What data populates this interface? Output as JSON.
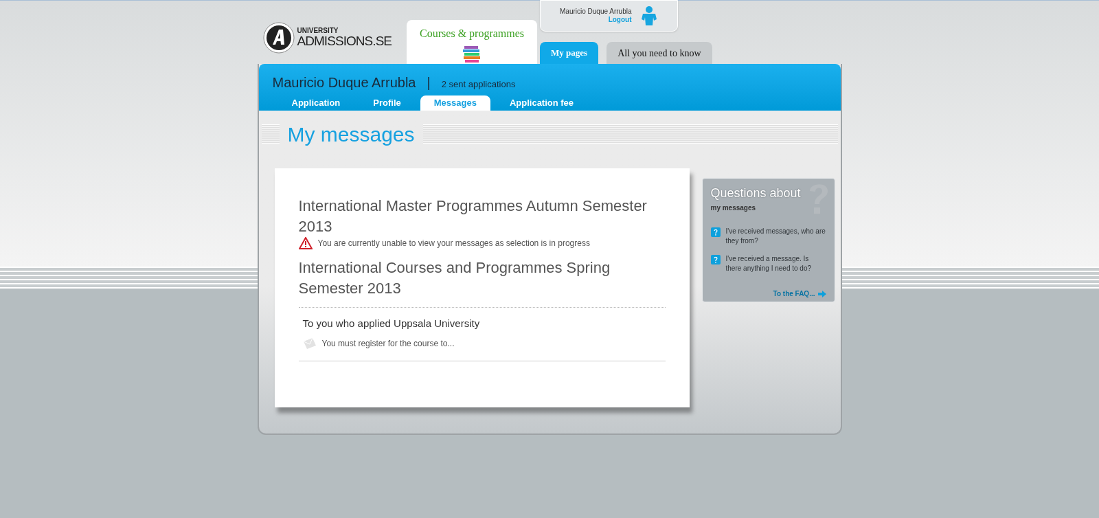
{
  "logo": {
    "small": "UNIVERSITY",
    "large": "ADMISSIONS.SE"
  },
  "courses_tab": {
    "label": "Courses & programmes"
  },
  "user_box": {
    "name": "Mauricio Duque Arrubla",
    "logout": "Logout"
  },
  "main_tabs": [
    {
      "label": "My pages",
      "selected": true
    },
    {
      "label": "All you need to know",
      "selected": false
    }
  ],
  "profile": {
    "name": "Mauricio Duque Arrubla",
    "separator": "|",
    "applications": "2 sent applications"
  },
  "sub_tabs": [
    {
      "label": "Application",
      "selected": false
    },
    {
      "label": "Profile",
      "selected": false
    },
    {
      "label": "Messages",
      "selected": true
    },
    {
      "label": "Application fee",
      "selected": false
    }
  ],
  "page_title": "My messages",
  "sections": [
    {
      "title": "International Master Programmes Autumn Semester 2013",
      "notice": "You are currently unable to view your messages as selection is in progress"
    },
    {
      "title": "International Courses and Programmes Spring Semester 2013",
      "messages": [
        {
          "subject": "To you who applied Uppsala University",
          "preview": "You must register for the course to..."
        }
      ]
    }
  ],
  "help": {
    "title": "Questions about",
    "subtitle": "my messages",
    "questions": [
      "I've received messages, who are they from?",
      "I've received a message. Is there anything I need to do?"
    ],
    "faq_link": "To the FAQ..."
  }
}
